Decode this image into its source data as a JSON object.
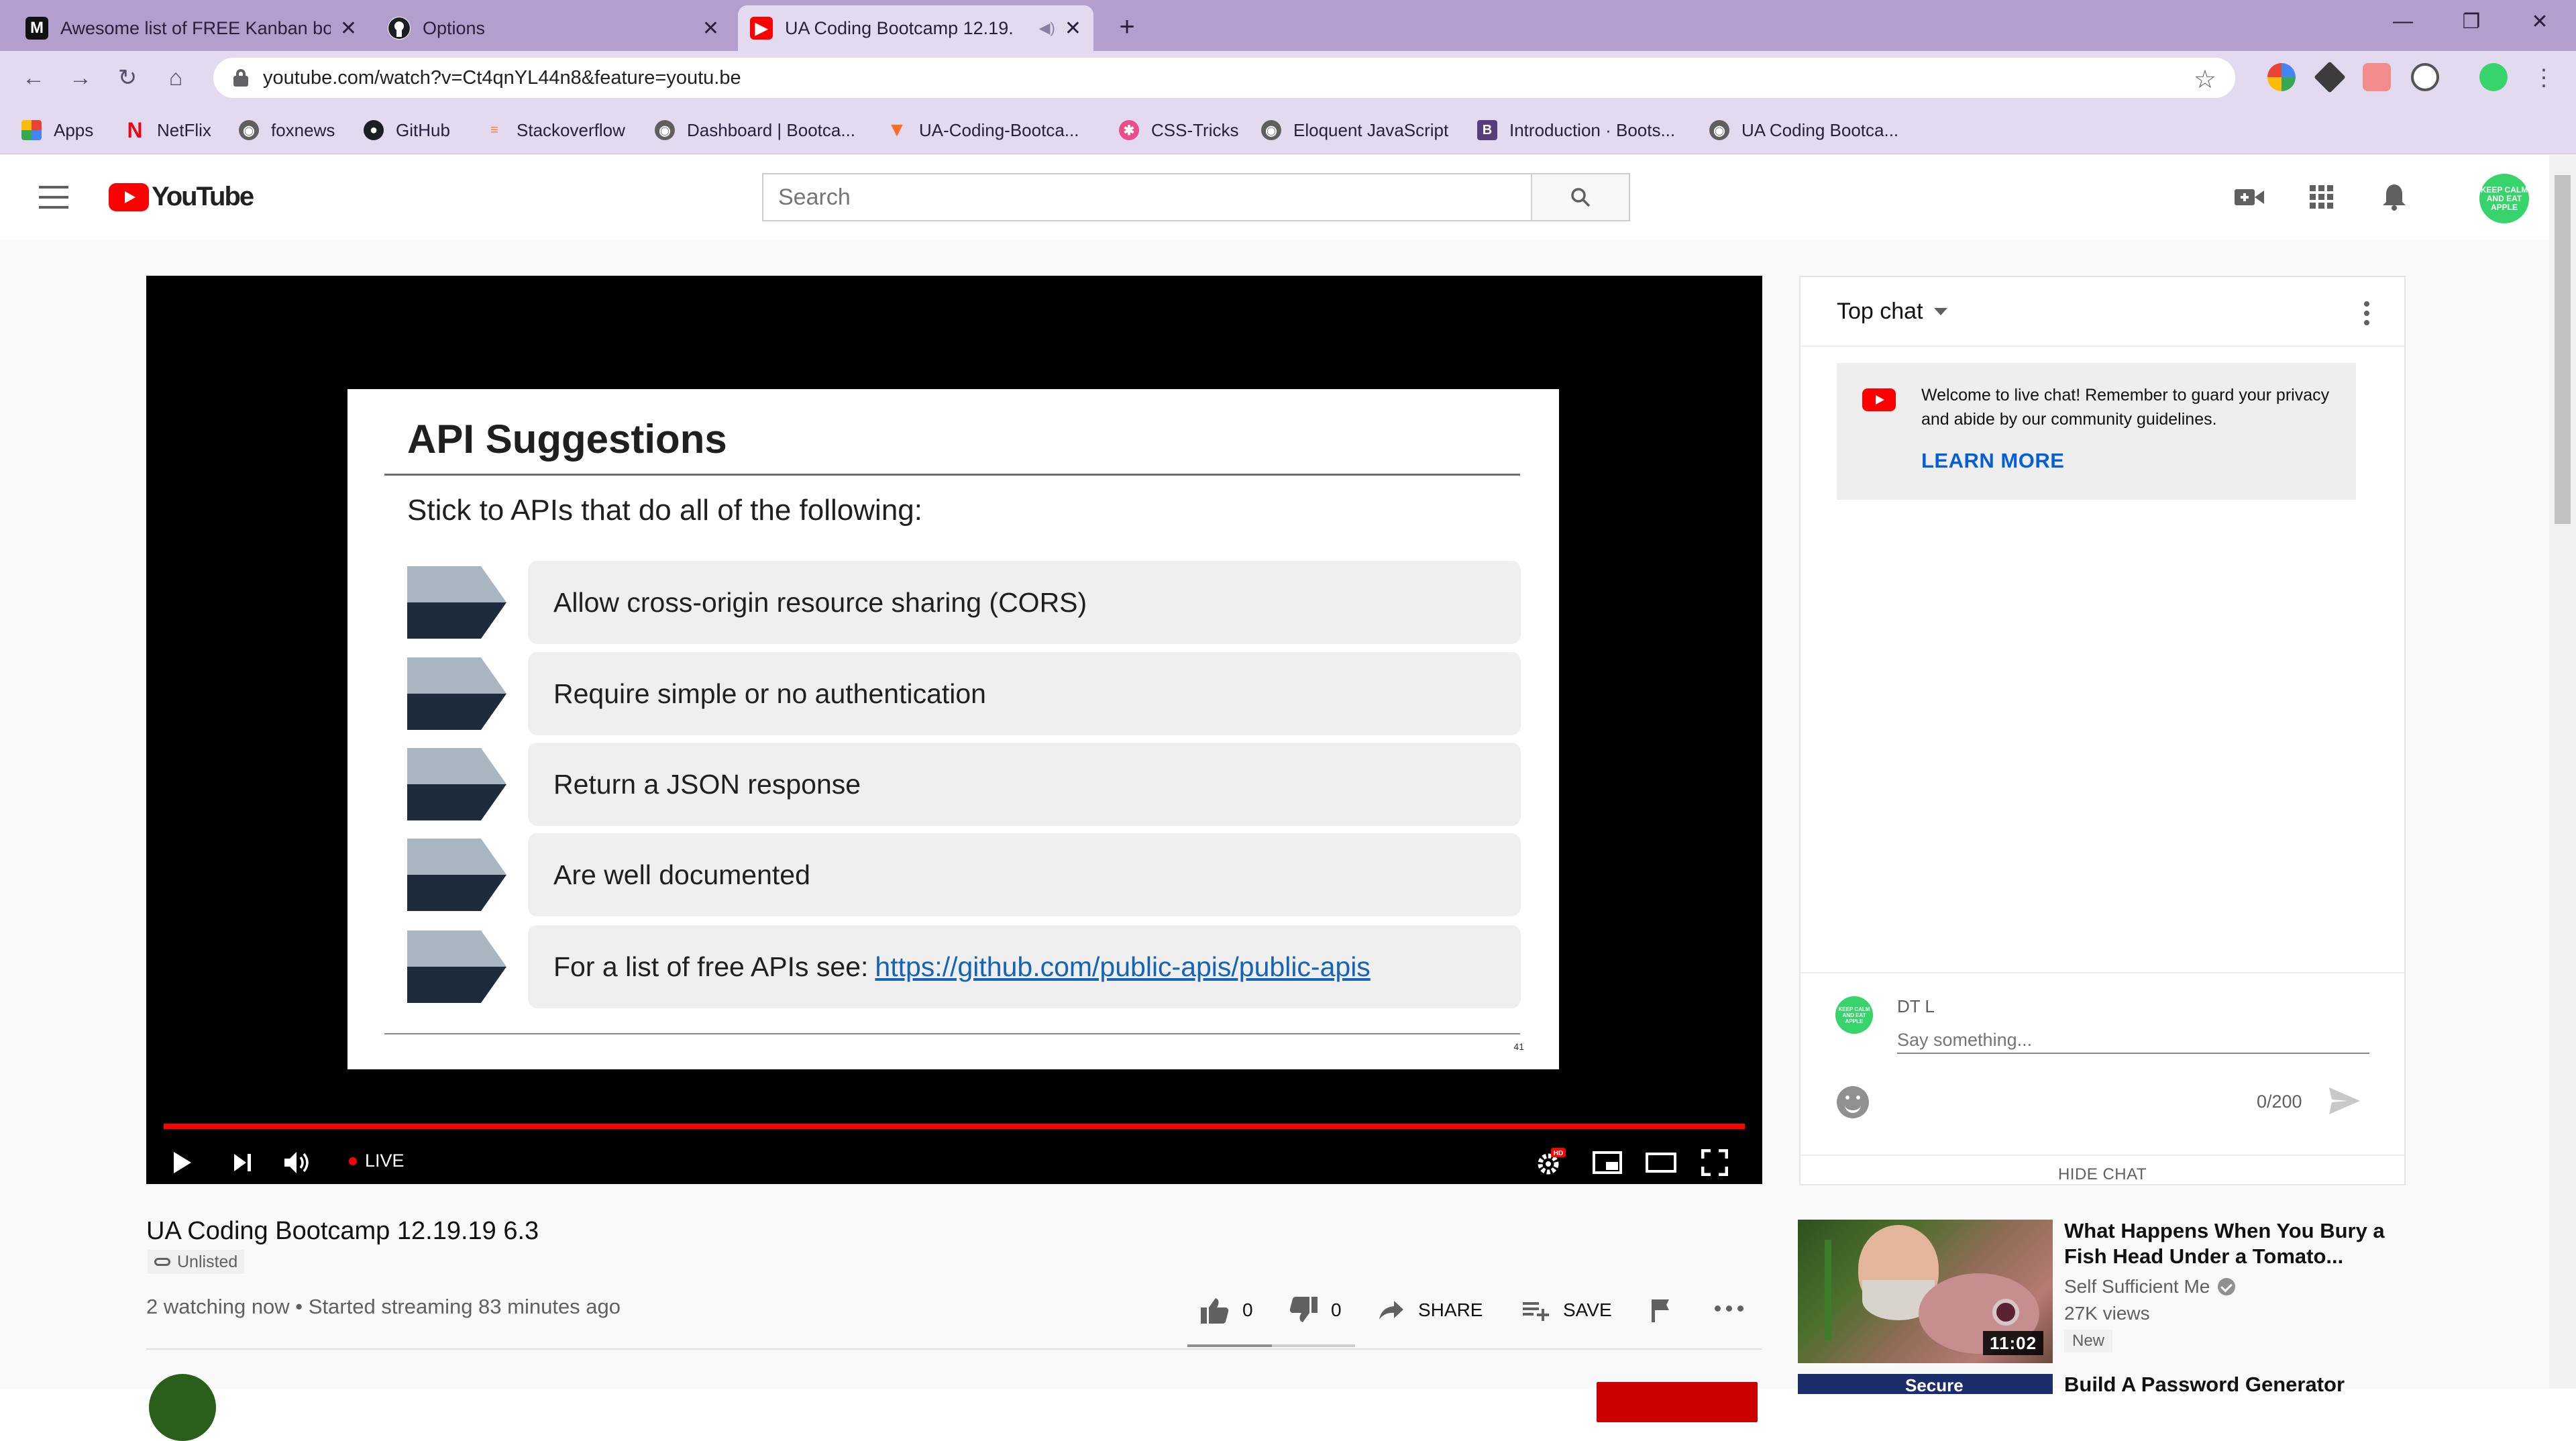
{
  "browser": {
    "tabs": [
      {
        "title": "Awesome list of FREE Kanban bo",
        "icon": "medium-icon"
      },
      {
        "title": "Options",
        "icon": "github-icon"
      },
      {
        "title": "UA Coding Bootcamp 12.19.",
        "icon": "youtube-icon"
      }
    ],
    "url": "youtube.com/watch?v=Ct4qnYL44n8&feature=youtu.be",
    "bookmarks": [
      "Apps",
      "NetFlix",
      "foxnews",
      "GitHub",
      "Stackoverflow",
      "Dashboard | Bootca...",
      "UA-Coding-Bootca...",
      "CSS-Tricks",
      "Eloquent JavaScript",
      "Introduction · Boots...",
      "UA Coding Bootca..."
    ]
  },
  "youtube": {
    "logo": "YouTube",
    "search_placeholder": "Search",
    "avatar_text": "KEEP CALM AND EAT APPLE"
  },
  "slide": {
    "title": "API Suggestions",
    "subtitle": "Stick to APIs that do all of the following:",
    "bullets": [
      "Allow cross-origin resource sharing (CORS)",
      "Require simple or no authentication",
      "Return a JSON response",
      "Are well documented"
    ],
    "last_bullet_prefix": "For a list of free APIs see:",
    "last_bullet_link": "https://github.com/public-apis/public-apis",
    "page_number": "41"
  },
  "player": {
    "live_label": "LIVE",
    "hd_badge": "HD"
  },
  "chat": {
    "mode": "Top chat",
    "welcome_text": "Welcome to live chat! Remember to guard your privacy and abide by our community guidelines.",
    "learn_more": "LEARN MORE",
    "user_name": "DT L",
    "input_placeholder": "Say something...",
    "char_count": "0/200",
    "hide_chat": "HIDE CHAT"
  },
  "video": {
    "title": "UA Coding Bootcamp 12.19.19 6.3",
    "visibility": "Unlisted",
    "meta": "2 watching now • Started streaming 83 minutes ago",
    "likes": "0",
    "dislikes": "0",
    "share_label": "SHARE",
    "save_label": "SAVE"
  },
  "recommendations": [
    {
      "title": "What Happens When You Bury a Fish Head Under a Tomato...",
      "channel": "Self Sufficient Me",
      "views": "27K views",
      "badge": "New",
      "duration": "11:02"
    },
    {
      "title": "Build A Password Generator",
      "thumb_text": "Secure"
    }
  ],
  "colors": {
    "chrome_tab_bar": "#b29fce",
    "chrome_toolbar": "#e3daf0",
    "youtube_red": "#ff0000",
    "link_blue": "#065fd4"
  }
}
